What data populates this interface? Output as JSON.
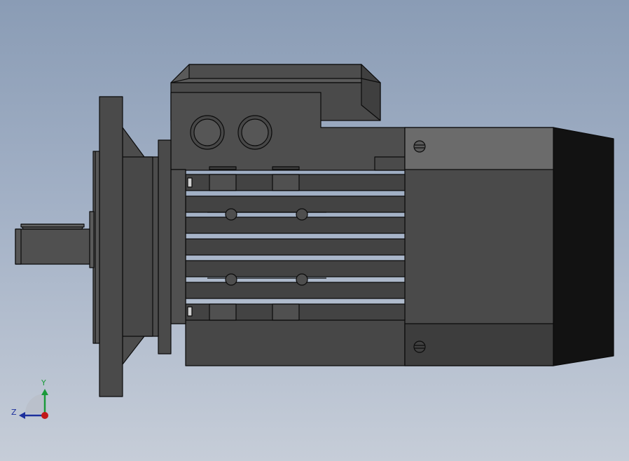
{
  "triad": {
    "y_label": "Y",
    "z_label": "Z",
    "y_color": "#1a9a3a",
    "z_color": "#1c2f9c",
    "x_color": "#c21818"
  },
  "colors": {
    "background_top": "#8a9cb5",
    "background_bottom": "#c6cdd8",
    "housing": "#4b4b4b",
    "housing_light": "#6a6a6a",
    "fan_cover": "#101010",
    "edge": "#0a0a0a"
  }
}
